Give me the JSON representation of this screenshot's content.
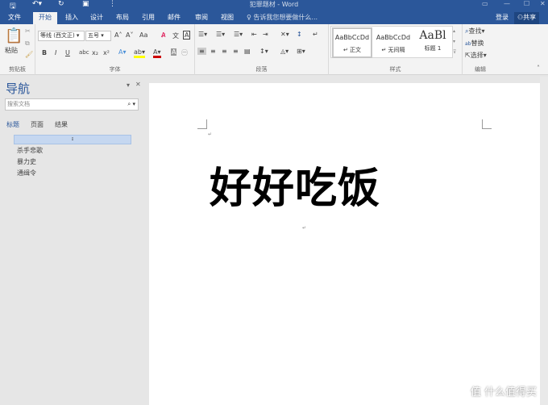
{
  "title": "犯罪题材 - Word",
  "tabs": [
    "文件",
    "开始",
    "插入",
    "设计",
    "布局",
    "引用",
    "邮件",
    "审阅",
    "视图"
  ],
  "tell_me": "告诉我您想要做什么...",
  "login": "登录",
  "share": "共享",
  "ribbon": {
    "clipboard": {
      "paste": "粘贴",
      "label": "剪贴板"
    },
    "font": {
      "name": "等线 (西文正)",
      "size": "五号",
      "label": "字体",
      "bold": "B",
      "italic": "I",
      "underline": "U",
      "strike": "abc",
      "sub": "x₂",
      "sup": "x²",
      "grow": "A˄",
      "shrink": "A˅",
      "case": "Aa"
    },
    "paragraph": {
      "label": "段落"
    },
    "styles": {
      "items": [
        {
          "preview": "AaBbCcDd",
          "name": "正文"
        },
        {
          "preview": "AaBbCcDd",
          "name": "无间隔"
        },
        {
          "preview": "AaBl",
          "name": "标题 1"
        }
      ],
      "label": "样式"
    },
    "editing": {
      "find": "查找",
      "replace": "替换",
      "select": "选择",
      "label": "编辑"
    }
  },
  "nav": {
    "title": "导航",
    "search_placeholder": "搜索文档",
    "tabs": [
      "标题",
      "页面",
      "结果"
    ],
    "items": [
      "杀手悲歌",
      "暴力史",
      "通缉令"
    ]
  },
  "document": {
    "heading": "好好吃饭"
  },
  "watermark": "值 什么值得买"
}
